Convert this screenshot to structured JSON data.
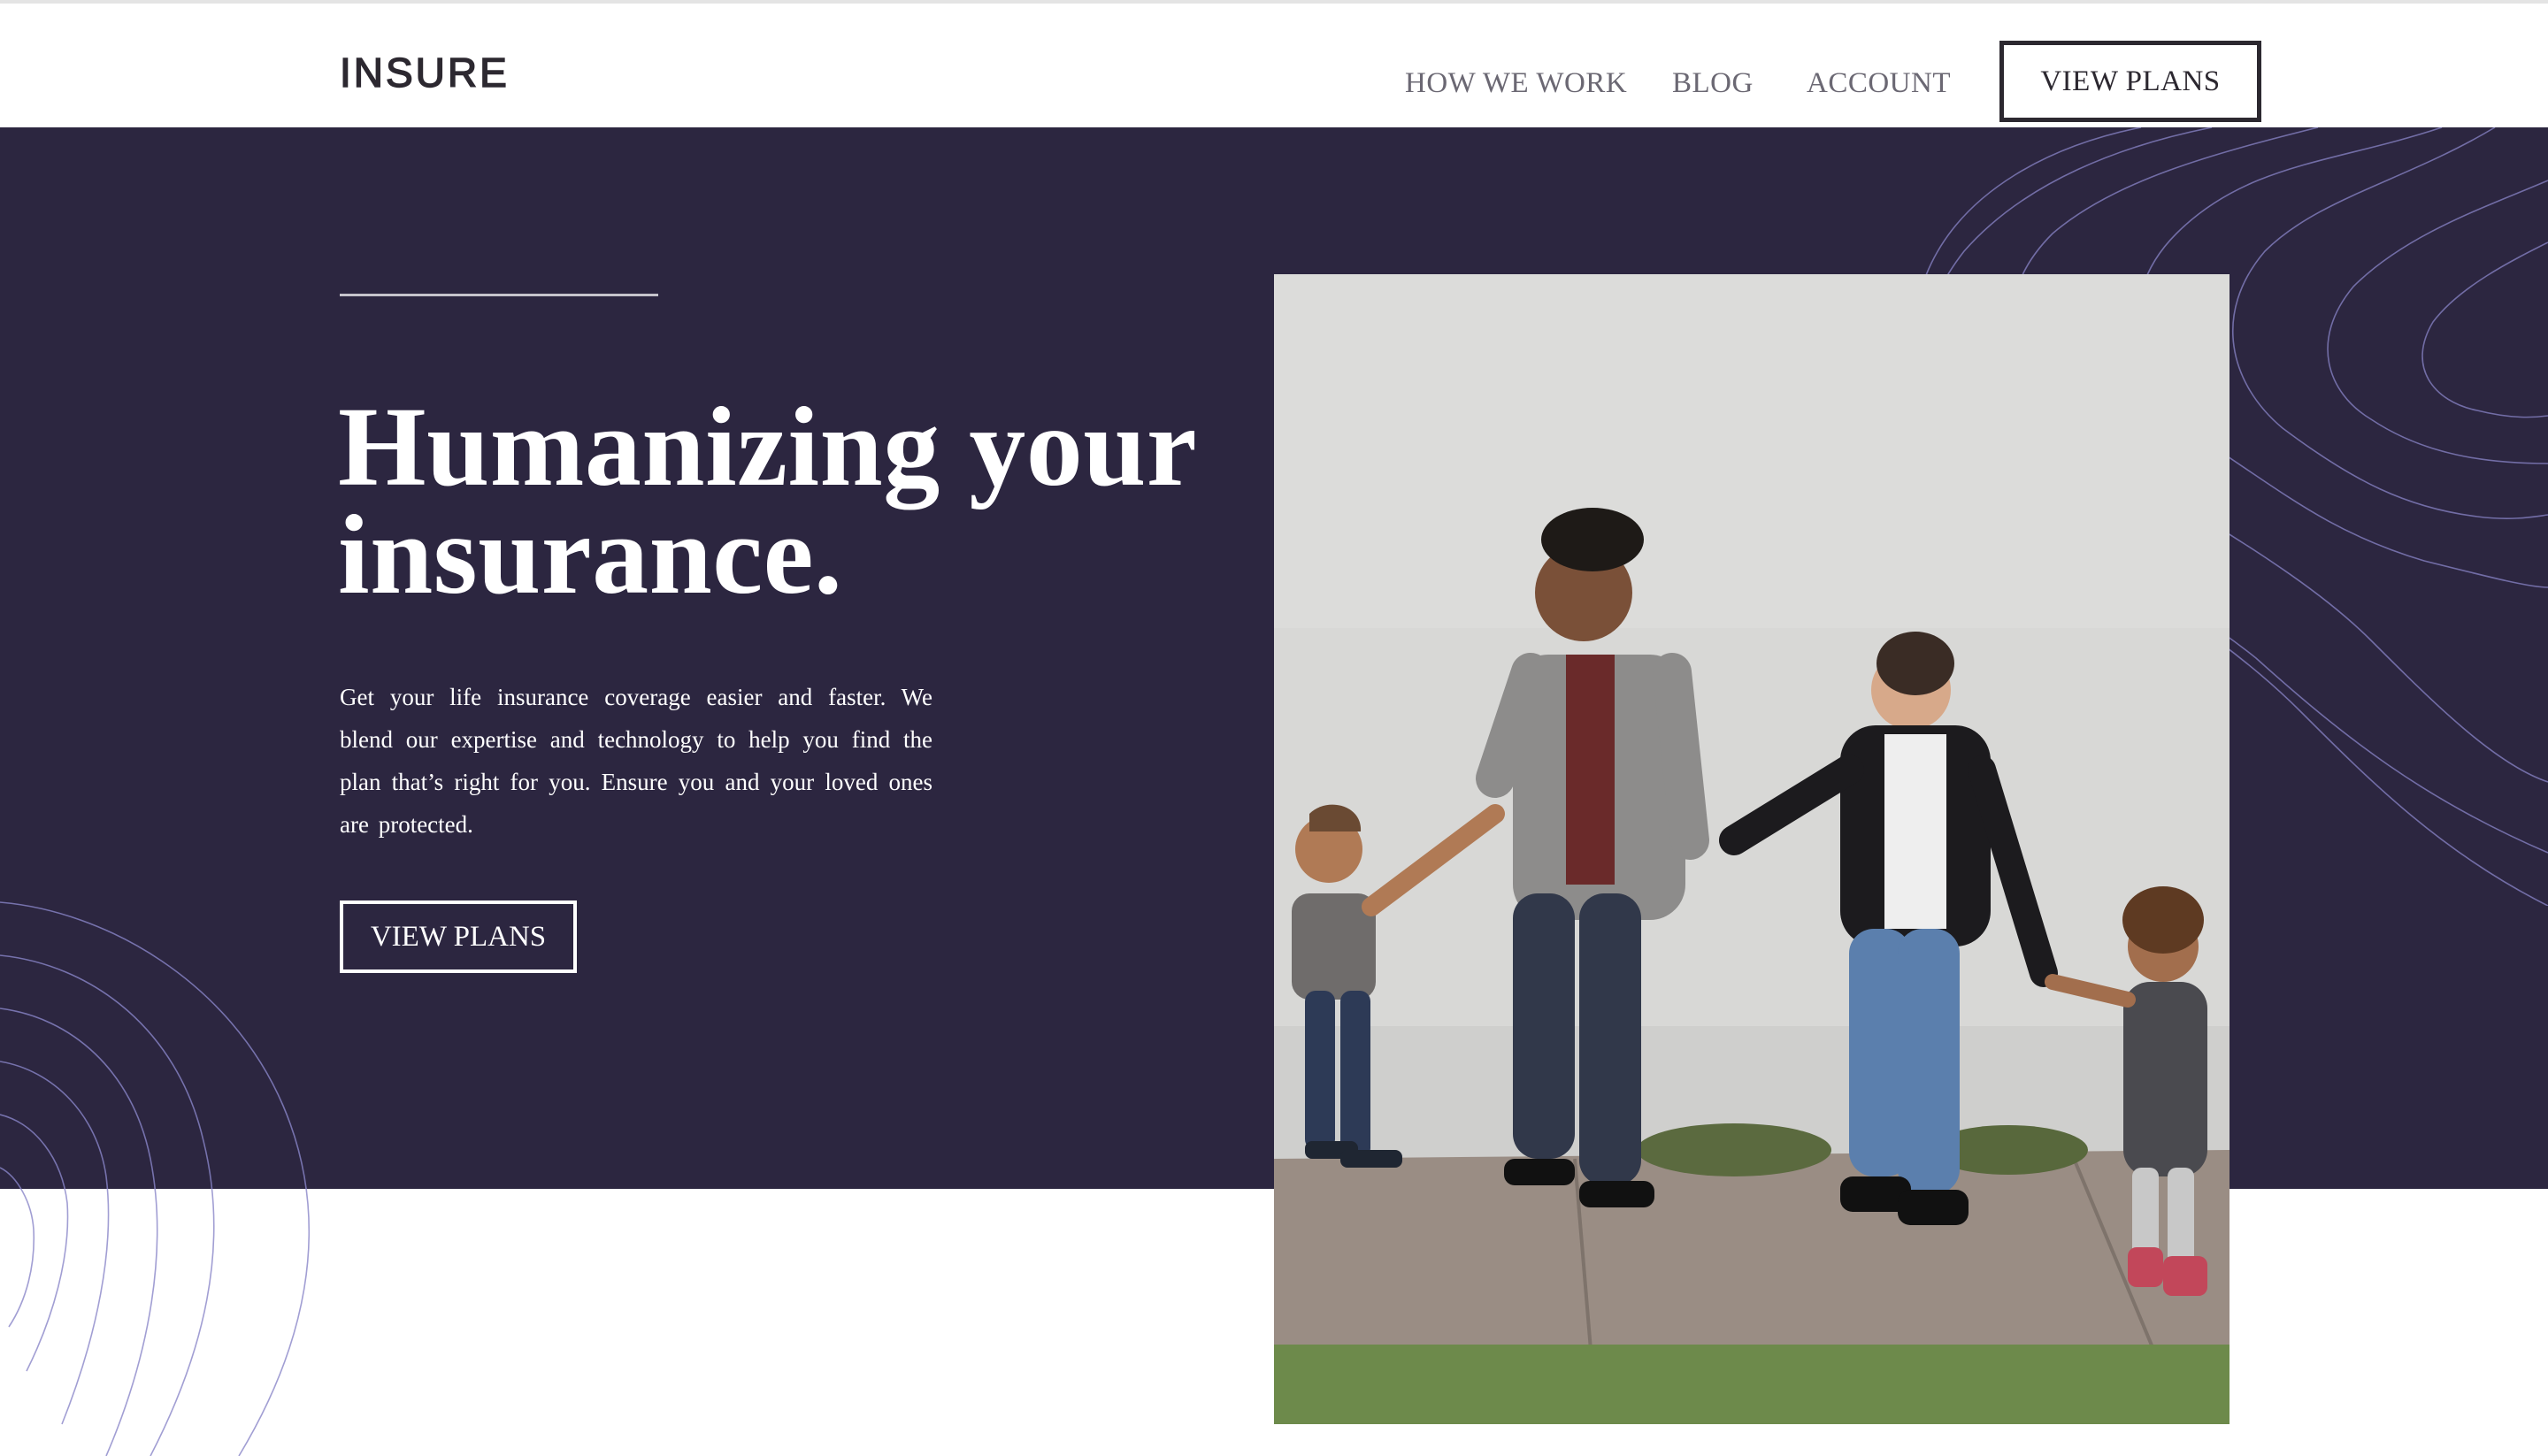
{
  "header": {
    "logo_text": "INSURE",
    "nav": {
      "how_we_work": "HOW WE WORK",
      "blog": "BLOG",
      "account": "ACCOUNT"
    },
    "cta_label": "VIEW PLANS"
  },
  "hero": {
    "title_line1": "Humanizing your",
    "title_line2": "insurance.",
    "description": "Get your life insurance coverage easier and faster. We blend our expertise and technology to help you find the plan that’s right for you. Ensure you and your loved ones are protected.",
    "cta_label": "VIEW PLANS"
  },
  "colors": {
    "hero_background": "#2c2640",
    "text_dark": "#2c2830",
    "nav_text": "#6b6873",
    "decoration_lines": "#8a86c8"
  },
  "icons": {
    "logo": "insure-wordmark",
    "decoration_left": "contour-lines-pattern",
    "decoration_right": "contour-lines-pattern"
  }
}
